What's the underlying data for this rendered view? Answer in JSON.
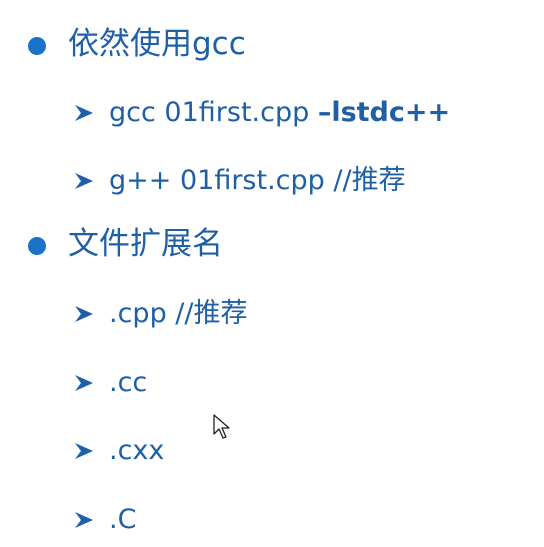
{
  "colors": {
    "text": "#1f5fa6",
    "bullet": "#1a73c9",
    "background": "#ffffff"
  },
  "sections": [
    {
      "title": "依然使用gcc",
      "items": [
        {
          "text": "gcc 01first.cpp ",
          "bold_suffix": "–lstdc++"
        },
        {
          "text": "g++ 01first.cpp //推荐",
          "bold_suffix": ""
        }
      ]
    },
    {
      "title": "文件扩展名",
      "items": [
        {
          "text": ".cpp //推荐",
          "bold_suffix": ""
        },
        {
          "text": ".cc",
          "bold_suffix": ""
        },
        {
          "text": ".cxx",
          "bold_suffix": ""
        },
        {
          "text": ".C",
          "bold_suffix": ""
        }
      ]
    }
  ],
  "icons": {
    "bullet_level1": "filled-circle-icon",
    "bullet_level2": "arrowhead-icon",
    "pointer": "mouse-cursor-icon"
  }
}
